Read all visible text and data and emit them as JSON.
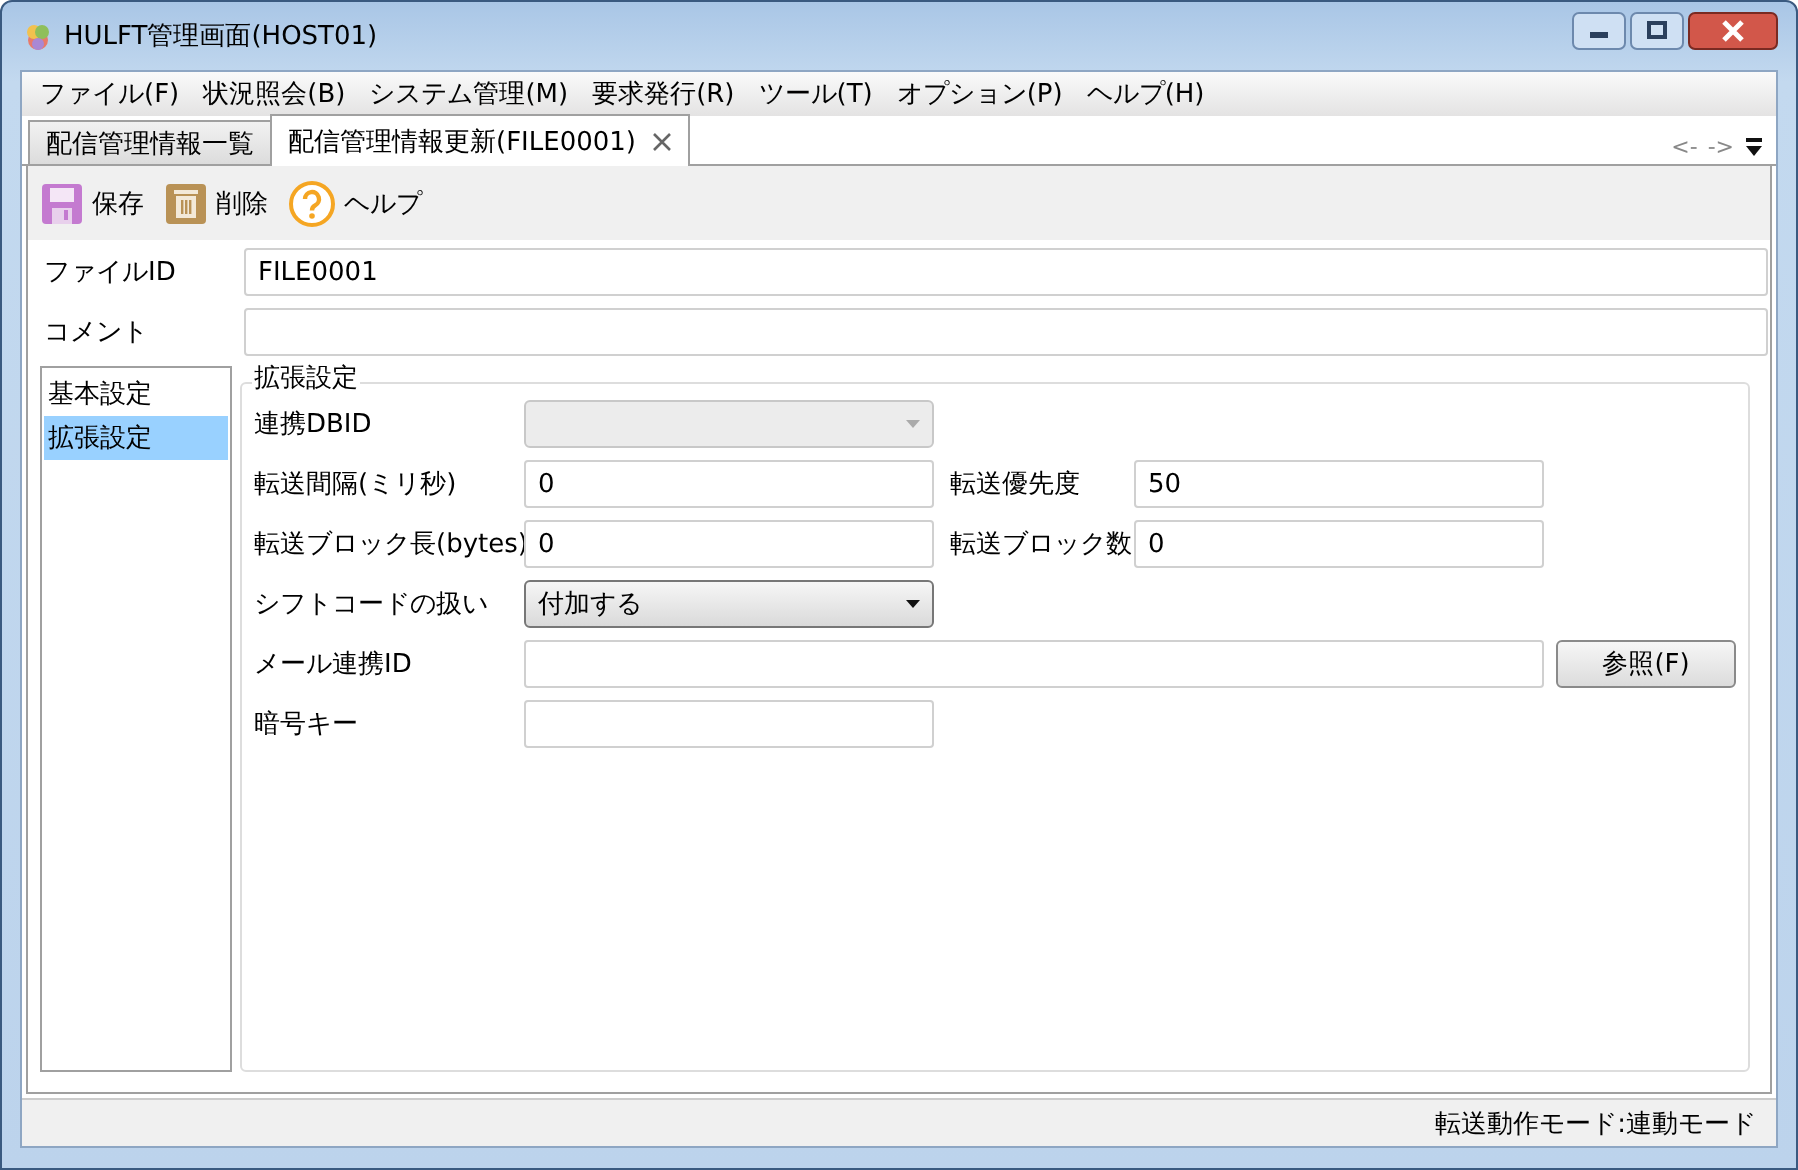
{
  "window": {
    "title": "HULFT管理画面(HOST01)"
  },
  "menu": [
    {
      "label": "ファイル(F)"
    },
    {
      "label": "状況照会(B)"
    },
    {
      "label": "システム管理(M)"
    },
    {
      "label": "要求発行(R)"
    },
    {
      "label": "ツール(T)"
    },
    {
      "label": "オプション(P)"
    },
    {
      "label": "ヘルプ(H)"
    }
  ],
  "tabs": [
    {
      "label": "配信管理情報一覧",
      "selected": false,
      "closable": false
    },
    {
      "label": "配信管理情報更新(FILE0001)",
      "selected": true,
      "closable": true
    }
  ],
  "tab_nav": {
    "back": "<-",
    "forward": "->"
  },
  "toolbar": [
    {
      "kind": "save",
      "label": "保存"
    },
    {
      "kind": "delete",
      "label": "削除"
    },
    {
      "kind": "help",
      "label": "ヘルプ"
    }
  ],
  "header_fields": [
    {
      "label": "ファイルID",
      "value": "FILE0001"
    },
    {
      "label": "コメント"
    }
  ],
  "sections": [
    {
      "label": "基本設定",
      "selected": false
    },
    {
      "label": "拡張設定",
      "selected": true
    }
  ],
  "group": {
    "title": "拡張設定",
    "rows": [
      [
        {
          "kind": "select",
          "label": "連携DBID",
          "disabled": true
        }
      ],
      [
        {
          "kind": "text",
          "label": "転送間隔(ミリ秒)",
          "value": "0"
        },
        {
          "kind": "text",
          "label": "転送優先度",
          "value": "50"
        }
      ],
      [
        {
          "kind": "text",
          "label": "転送ブロック長(bytes)",
          "value": "0"
        },
        {
          "kind": "text",
          "label": "転送ブロック数",
          "value": "0"
        }
      ],
      [
        {
          "kind": "select",
          "label": "シフトコードの扱い",
          "value": "付加する",
          "disabled": false
        }
      ],
      [
        {
          "kind": "wide",
          "label": "メール連携ID"
        },
        {
          "kind": "button",
          "label": "参照(F)"
        }
      ],
      [
        {
          "kind": "text",
          "label": "暗号キー"
        }
      ]
    ]
  },
  "status_bar": {
    "text": "転送動作モード:連動モード"
  }
}
